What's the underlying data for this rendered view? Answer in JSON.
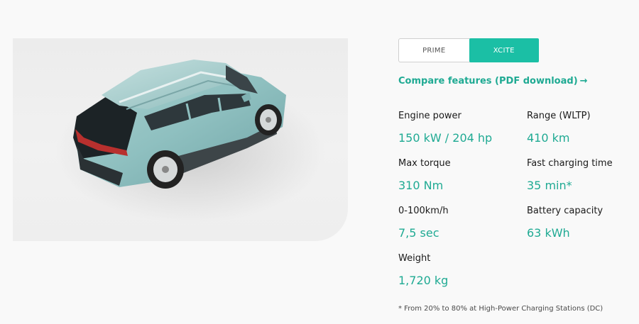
{
  "trim_options": [
    {
      "label": "PRIME",
      "active": false
    },
    {
      "label": "XCITE",
      "active": true
    }
  ],
  "compare_link": {
    "label": "Compare features (PDF download)",
    "arrow": "→"
  },
  "specs": [
    {
      "label": "Engine power",
      "value": "150 kW / 204 hp"
    },
    {
      "label": "Range (WLTP)",
      "value": "410 km"
    },
    {
      "label": "Max torque",
      "value": "310 Nm"
    },
    {
      "label": "Fast charging time",
      "value": "35 min*"
    },
    {
      "label": "0-100km/h",
      "value": "7,5 sec"
    },
    {
      "label": "Battery capacity",
      "value": "63 kWh"
    },
    {
      "label": "Weight",
      "value": "1,720 kg"
    }
  ],
  "footnote": "* From 20% to 80% at High-Power Charging Stations (DC)",
  "colors": {
    "accent": "#1bbfa5",
    "accent_text": "#1faa93",
    "car_body": "#8fc0c0"
  }
}
